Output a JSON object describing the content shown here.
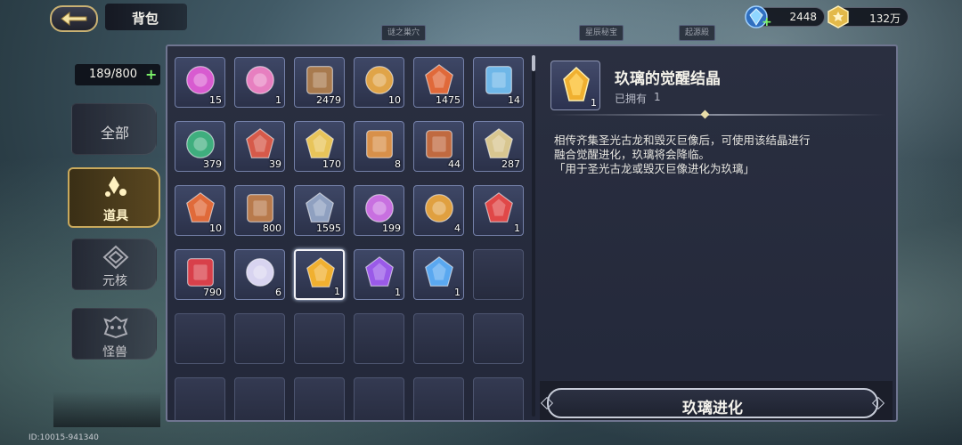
{
  "header": {
    "title": "背包"
  },
  "currency": {
    "gems": {
      "value": "2448",
      "icon": "blue-gem-icon"
    },
    "gold": {
      "value": "132万",
      "icon": "gold-coin-icon"
    }
  },
  "inventory": {
    "capacity": "189/800"
  },
  "tabs": [
    {
      "label": "全部",
      "active": false
    },
    {
      "label": "道具",
      "active": true,
      "icon": "items-icon"
    },
    {
      "label": "元核",
      "active": false,
      "icon": "core-icon"
    },
    {
      "label": "怪兽",
      "active": false,
      "icon": "monster-icon"
    }
  ],
  "panel_tabs": [
    "谜之巢穴",
    "星辰秘宝",
    "起源殿"
  ],
  "items": [
    {
      "icon": "potion-icon",
      "count": "15",
      "color": "#d85bd0"
    },
    {
      "icon": "mask-icon",
      "count": "1",
      "color": "#e77fc0"
    },
    {
      "icon": "scroll-bundle-icon",
      "count": "2479",
      "color": "#a87a4e"
    },
    {
      "icon": "amulet-icon",
      "count": "10",
      "color": "#e0a448"
    },
    {
      "icon": "flame-crest-icon",
      "count": "1475",
      "color": "#e0693a"
    },
    {
      "icon": "puzzle-icon",
      "count": "14",
      "color": "#6fb7e8"
    },
    {
      "icon": "green-orb-icon",
      "count": "379",
      "color": "#3fae7e"
    },
    {
      "icon": "red-gem-icon",
      "count": "39",
      "color": "#d65a4a"
    },
    {
      "icon": "winged-star-icon",
      "count": "170",
      "color": "#e8c45a"
    },
    {
      "icon": "magnifier-card-icon",
      "count": "8",
      "color": "#d8904a"
    },
    {
      "icon": "hourglass-badge-icon",
      "count": "44",
      "color": "#c06a40"
    },
    {
      "icon": "ore-icon",
      "count": "287",
      "color": "#d8c690"
    },
    {
      "icon": "fire-rune-icon",
      "count": "10",
      "color": "#e06a3a"
    },
    {
      "icon": "wood-tablet-icon",
      "count": "800",
      "color": "#b87a4c"
    },
    {
      "icon": "crossed-swords-icon",
      "count": "1595",
      "color": "#8fa0c0"
    },
    {
      "icon": "purple-swirl-icon",
      "count": "199",
      "color": "#c870e0"
    },
    {
      "icon": "golden-eye-icon",
      "count": "4",
      "color": "#e0a040"
    },
    {
      "icon": "red-cross-icon",
      "count": "1",
      "color": "#e04848"
    },
    {
      "icon": "red-crest-icon",
      "count": "790",
      "color": "#d8404a"
    },
    {
      "icon": "white-flower-icon",
      "count": "6",
      "color": "#d8d4f0"
    },
    {
      "icon": "gold-crystal-icon",
      "count": "1",
      "color": "#f0b030",
      "selected": true
    },
    {
      "icon": "purple-crystal-icon",
      "count": "1",
      "color": "#9a5ae8"
    },
    {
      "icon": "blue-crystal-icon",
      "count": "1",
      "color": "#5aa8f0"
    }
  ],
  "detail": {
    "name": "玖璃的觉醒结晶",
    "owned_label": "已拥有",
    "owned_value": "1",
    "icon_count": "1",
    "description": "相传齐集圣光古龙和毁灭巨像后，可使用该结晶进行\n融合觉醒进化，玖璃将会降临。\n「用于圣光古龙或毁灭巨像进化为玖璃」"
  },
  "action": {
    "label": "玖璃进化"
  },
  "footer": {
    "id_text": "ID:10015-941340"
  }
}
